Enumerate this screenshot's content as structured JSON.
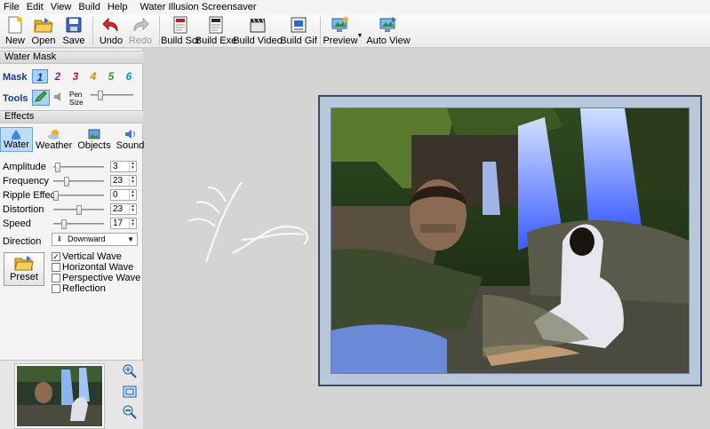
{
  "menubar": {
    "items": [
      "File",
      "Edit",
      "View",
      "Build",
      "Help"
    ],
    "title": "Water Illusion Screensaver"
  },
  "toolbar": {
    "new": "New",
    "open": "Open",
    "save": "Save",
    "undo": "Undo",
    "redo": "Redo",
    "build_scr": "Build Scr",
    "build_exe": "Build Exe",
    "build_video": "Build Video",
    "build_gif": "Build Gif",
    "preview": "Preview",
    "auto_view": "Auto View"
  },
  "water_mask": {
    "header": "Water Mask",
    "mask_label": "Mask",
    "masks": [
      "1",
      "2",
      "3",
      "4",
      "5",
      "6"
    ],
    "mask_colors": [
      "#1a2fa8",
      "#7a2aa0",
      "#c01818",
      "#d08a10",
      "#2e9a2e",
      "#0a9ab0"
    ],
    "tools_label": "Tools",
    "pen_size_label": "Pen Size",
    "pen_size": 0.2
  },
  "effects": {
    "header": "Effects",
    "tabs": [
      "Water",
      "Weather",
      "Objects",
      "Sound"
    ],
    "params": [
      {
        "label": "Amplitude",
        "value": "3",
        "slider": 0.03
      },
      {
        "label": "Frequency",
        "value": "23",
        "slider": 0.23
      },
      {
        "label": "Ripple Effect",
        "value": "0",
        "slider": 0.0
      },
      {
        "label": "Distortion",
        "value": "23",
        "slider": 0.5
      },
      {
        "label": "Speed",
        "value": "17",
        "slider": 0.17
      }
    ],
    "direction_label": "Direction",
    "direction_value": "Downward",
    "preset": "Preset",
    "checks": [
      {
        "label": "Vertical Wave",
        "checked": true
      },
      {
        "label": "Horizontal Wave",
        "checked": false
      },
      {
        "label": "Perspective Wave",
        "checked": false
      },
      {
        "label": "Reflection",
        "checked": false
      }
    ]
  },
  "colors": {
    "accent": "#1a3a8a",
    "frame": "#3b4a6b",
    "frame_bg": "#b9c7db"
  }
}
